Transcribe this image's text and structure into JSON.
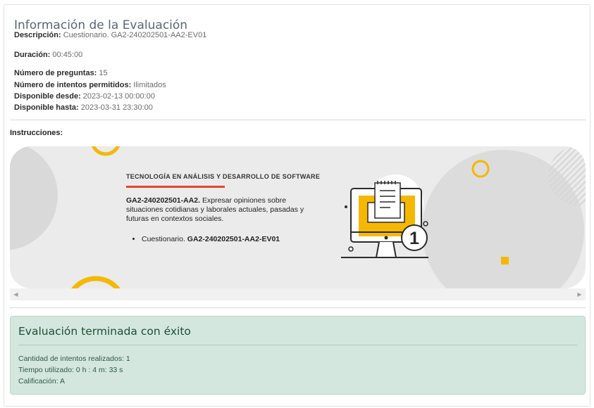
{
  "evaluation": {
    "title": "Información de la Evaluación",
    "description_label": "Descripción:",
    "description_value": " Cuestionario. GA2-240202501-AA2-EV01",
    "duration_label": "Duración:",
    "duration_value": " 00:45:00",
    "questions_label": "Número de preguntas:",
    "questions_value": " 15",
    "attempts_label": "Número de intentos permitidos:",
    "attempts_value": " Ilimitados",
    "available_from_label": "Disponible desde:",
    "available_from_value": " 2023-02-13 00:00:00",
    "available_until_label": "Disponible hasta:",
    "available_until_value": " 2023-03-31 23:30:00",
    "instructions_label": "Instrucciones:"
  },
  "banner": {
    "heading": "TECNOLOGÍA EN ANÁLISIS Y DESARROLLO DE SOFTWARE",
    "code": "GA2-240202501-AA2.",
    "description": " Expresar opiniones sobre situaciones cotidianas y laborales actuales, pasadas y futuras en contextos sociales.",
    "item_prefix": "Cuestionario. ",
    "item_code": "GA2-240202501-AA2-EV01",
    "badge_number": "1",
    "colors": {
      "accent_yellow": "#f5b800",
      "accent_red": "#e0472c",
      "background": "#ebebeb"
    },
    "icon": "computer-document-icon"
  },
  "scrollbar": {
    "left_arrow": "◀",
    "right_arrow": "▶"
  },
  "result": {
    "title": "Evaluación terminada con éxito",
    "attempts": "Cantidad de intentos realizados: 1",
    "time_used": "Tiempo utilizado: 0 h : 4 m: 33 s",
    "grade": "Calificación: A",
    "colors": {
      "background": "#d4e7df",
      "text": "#1f4d36"
    }
  }
}
